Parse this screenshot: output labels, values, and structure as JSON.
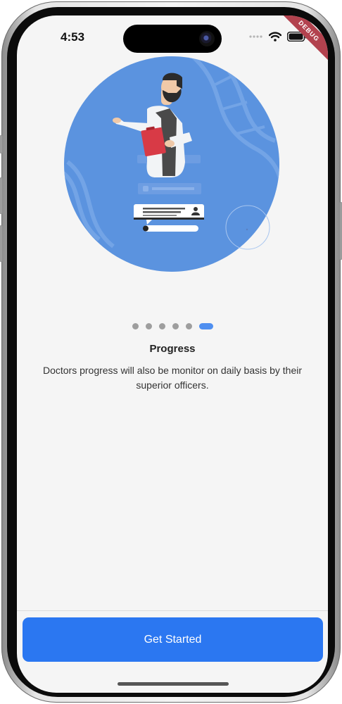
{
  "status_bar": {
    "time": "4:53",
    "debug_banner": "DEBUG"
  },
  "onboarding": {
    "page_count": 6,
    "active_index": 5,
    "title": "Progress",
    "description": "Doctors progress will also be monitor on daily basis by their superior officers."
  },
  "actions": {
    "get_started_label": "Get Started"
  },
  "colors": {
    "accent": "#2B77F1",
    "hero_circle": "#5B93DF",
    "inactive_dot": "#9E9E9E",
    "active_dot": "#4F8FF0",
    "clipboard": "#D83A46"
  },
  "icons": [
    "wifi-icon",
    "battery-icon",
    "cellular-icon",
    "doctor-illustration"
  ]
}
